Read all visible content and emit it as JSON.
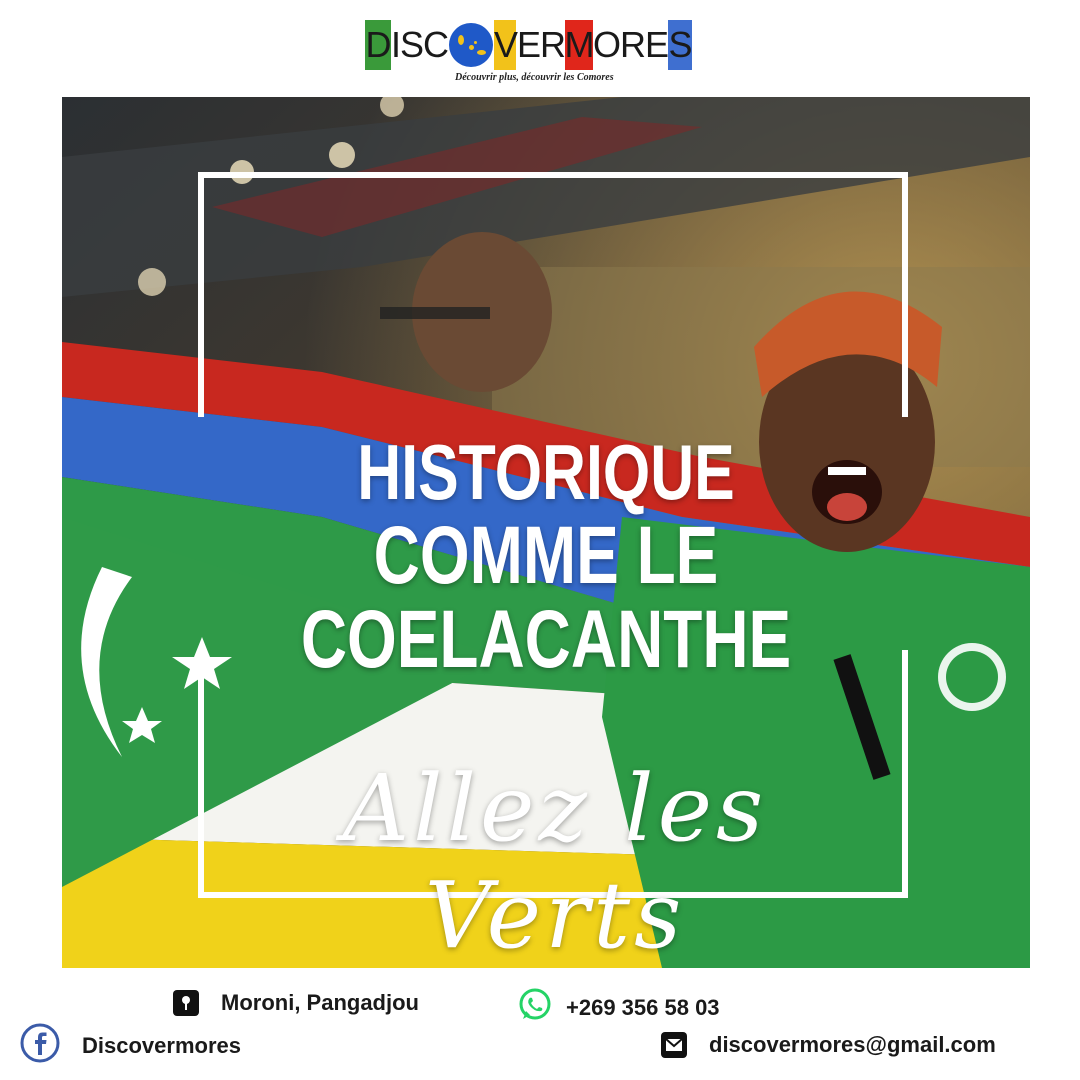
{
  "logo": {
    "letters": [
      "D",
      "ISC",
      "VER",
      "M",
      "ORE",
      "S"
    ],
    "tagline": "Découvrir plus, découvrir les Comores"
  },
  "headline": {
    "line1": "HISTORIQUE",
    "line2": "COMME LE COELACANTHE"
  },
  "script_text": "Allez les Verts",
  "footer": {
    "location": "Moroni, Pangadjou",
    "phone": "+269 356 58 03",
    "facebook": "Discovermores",
    "email": "discovermores@gmail.com"
  },
  "colors": {
    "green": "#3a9a3a",
    "yellow": "#f2c21a",
    "red": "#e0261b",
    "blue": "#3f6fd0",
    "whatsapp": "#25d366",
    "facebook": "#3b5ba8"
  },
  "icons": [
    "map-pin-icon",
    "whatsapp-icon",
    "facebook-icon",
    "envelope-icon"
  ]
}
